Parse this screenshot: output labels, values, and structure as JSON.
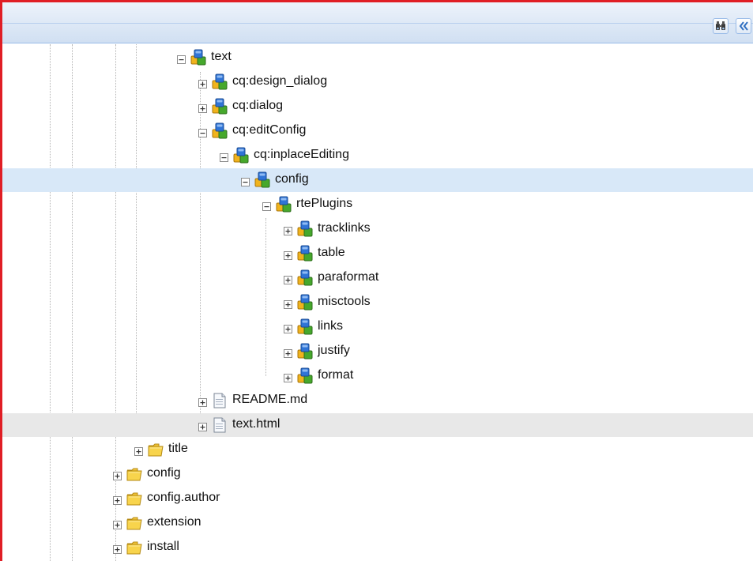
{
  "toolbar": {
    "find_icon": "binoculars-icon",
    "collapse_icon": "double-chevron-left-icon"
  },
  "tree": {
    "rows": [
      {
        "label": "text",
        "icon": "node-icon",
        "toggle": "collapse",
        "depth": 8,
        "state": "normal"
      },
      {
        "label": "cq:design_dialog",
        "icon": "node-icon",
        "toggle": "expand",
        "depth": 9,
        "state": "normal"
      },
      {
        "label": "cq:dialog",
        "icon": "node-icon",
        "toggle": "expand",
        "depth": 9,
        "state": "normal"
      },
      {
        "label": "cq:editConfig",
        "icon": "node-icon",
        "toggle": "collapse",
        "depth": 9,
        "state": "normal"
      },
      {
        "label": "cq:inplaceEditing",
        "icon": "node-icon",
        "toggle": "collapse",
        "depth": 10,
        "state": "normal"
      },
      {
        "label": "config",
        "icon": "node-icon",
        "toggle": "collapse",
        "depth": 11,
        "state": "selected"
      },
      {
        "label": "rtePlugins",
        "icon": "node-icon",
        "toggle": "collapse",
        "depth": 12,
        "state": "normal"
      },
      {
        "label": "tracklinks",
        "icon": "node-icon",
        "toggle": "expand",
        "depth": 13,
        "state": "normal"
      },
      {
        "label": "table",
        "icon": "node-icon",
        "toggle": "expand",
        "depth": 13,
        "state": "normal"
      },
      {
        "label": "paraformat",
        "icon": "node-icon",
        "toggle": "expand",
        "depth": 13,
        "state": "normal"
      },
      {
        "label": "misctools",
        "icon": "node-icon",
        "toggle": "expand",
        "depth": 13,
        "state": "normal"
      },
      {
        "label": "links",
        "icon": "node-icon",
        "toggle": "expand",
        "depth": 13,
        "state": "normal"
      },
      {
        "label": "justify",
        "icon": "node-icon",
        "toggle": "expand",
        "depth": 13,
        "state": "normal"
      },
      {
        "label": "format",
        "icon": "node-icon",
        "toggle": "expand",
        "depth": 13,
        "state": "normal"
      },
      {
        "label": "README.md",
        "icon": "file-icon",
        "toggle": "expand",
        "depth": 9,
        "state": "normal"
      },
      {
        "label": "text.html",
        "icon": "file-icon",
        "toggle": "expand",
        "depth": 9,
        "state": "hover"
      },
      {
        "label": "title",
        "icon": "folder-icon",
        "toggle": "expand",
        "depth": 6,
        "state": "normal"
      },
      {
        "label": "config",
        "icon": "folder-icon",
        "toggle": "expand",
        "depth": 5,
        "state": "normal"
      },
      {
        "label": "config.author",
        "icon": "folder-icon",
        "toggle": "expand",
        "depth": 5,
        "state": "normal"
      },
      {
        "label": "extension",
        "icon": "folder-icon",
        "toggle": "expand",
        "depth": 5,
        "state": "normal"
      },
      {
        "label": "install",
        "icon": "folder-icon",
        "toggle": "expand",
        "depth": 5,
        "state": "normal"
      }
    ]
  },
  "colors": {
    "accent_border": "#e01e25",
    "selected_row": "#d8e8f8",
    "hover_row": "#e8e8e8",
    "toolbar": "#d0dff2"
  }
}
